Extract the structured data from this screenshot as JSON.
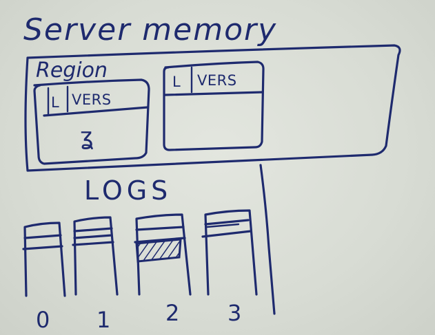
{
  "diagram": {
    "title": "Server memory",
    "region_label": "Region",
    "tables": [
      {
        "col_l": "L",
        "col_vers": "VERS",
        "content": "ʓ"
      },
      {
        "col_l": "L",
        "col_vers": "VERS",
        "content": ""
      }
    ],
    "logs_label": "LOGS",
    "logs": [
      {
        "label": "0",
        "entries": 2,
        "hatched": false
      },
      {
        "label": "1",
        "entries": 3,
        "hatched": false
      },
      {
        "label": "2",
        "entries": 2,
        "hatched": true
      },
      {
        "label": "3",
        "entries": 3,
        "hatched": false
      }
    ],
    "ink_color": "#1e2a6e",
    "board_color": "#d9ddd6"
  }
}
